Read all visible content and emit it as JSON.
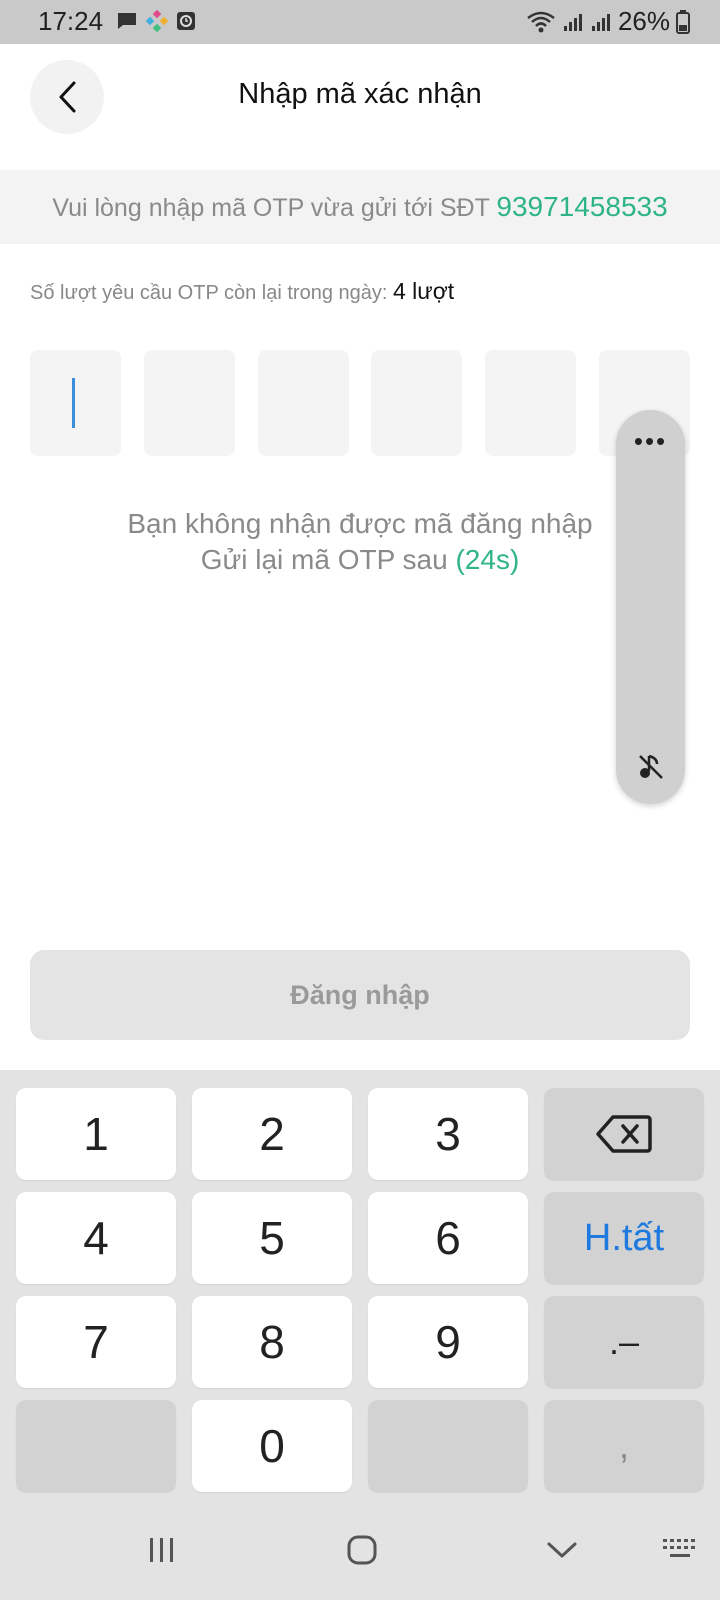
{
  "status_bar": {
    "time": "17:24",
    "battery": "26%",
    "left_icons": [
      "message-icon",
      "app-icon",
      "clock-app-icon"
    ],
    "right_icons": [
      "wifi-icon",
      "signal-icon",
      "signal-icon",
      "battery-icon"
    ]
  },
  "header": {
    "title": "Nhập mã xác nhận",
    "back_icon": "chevron-left-icon"
  },
  "info": {
    "prefix": "Vui lòng nhập mã OTP vừa gửi tới SĐT ",
    "phone": "93971458533",
    "phone_color": "#2fb48a"
  },
  "quota": {
    "label": "Số lượt yêu cầu OTP còn lại trong ngày: ",
    "count": "4 lượt"
  },
  "otp": {
    "digits": [
      "",
      "",
      "",
      "",
      "",
      ""
    ]
  },
  "resend": {
    "line1": "Bạn không nhận được mã đăng nhập",
    "line2_prefix": "Gửi lại mã OTP sau ",
    "timer": "(24s)"
  },
  "float_panel": {
    "menu_icon": "more-horizontal-icon",
    "mute_icon": "music-off-icon"
  },
  "login_button": {
    "label": "Đăng nhập"
  },
  "keyboard": {
    "keys": [
      "1",
      "2",
      "3",
      "4",
      "5",
      "6",
      "7",
      "8",
      "9",
      "0"
    ],
    "done_label": "H.tất",
    "symbol_label": ".–",
    "comma_label": ",",
    "backspace_icon": "backspace-icon"
  },
  "nav": {
    "recents_icon": "recents-icon",
    "home_icon": "home-icon",
    "back_icon": "hide-keyboard-icon",
    "keyboard_icon": "keyboard-icon"
  },
  "colors": {
    "accent_green": "#2fb48a",
    "key_blue": "#1f7ae0"
  }
}
